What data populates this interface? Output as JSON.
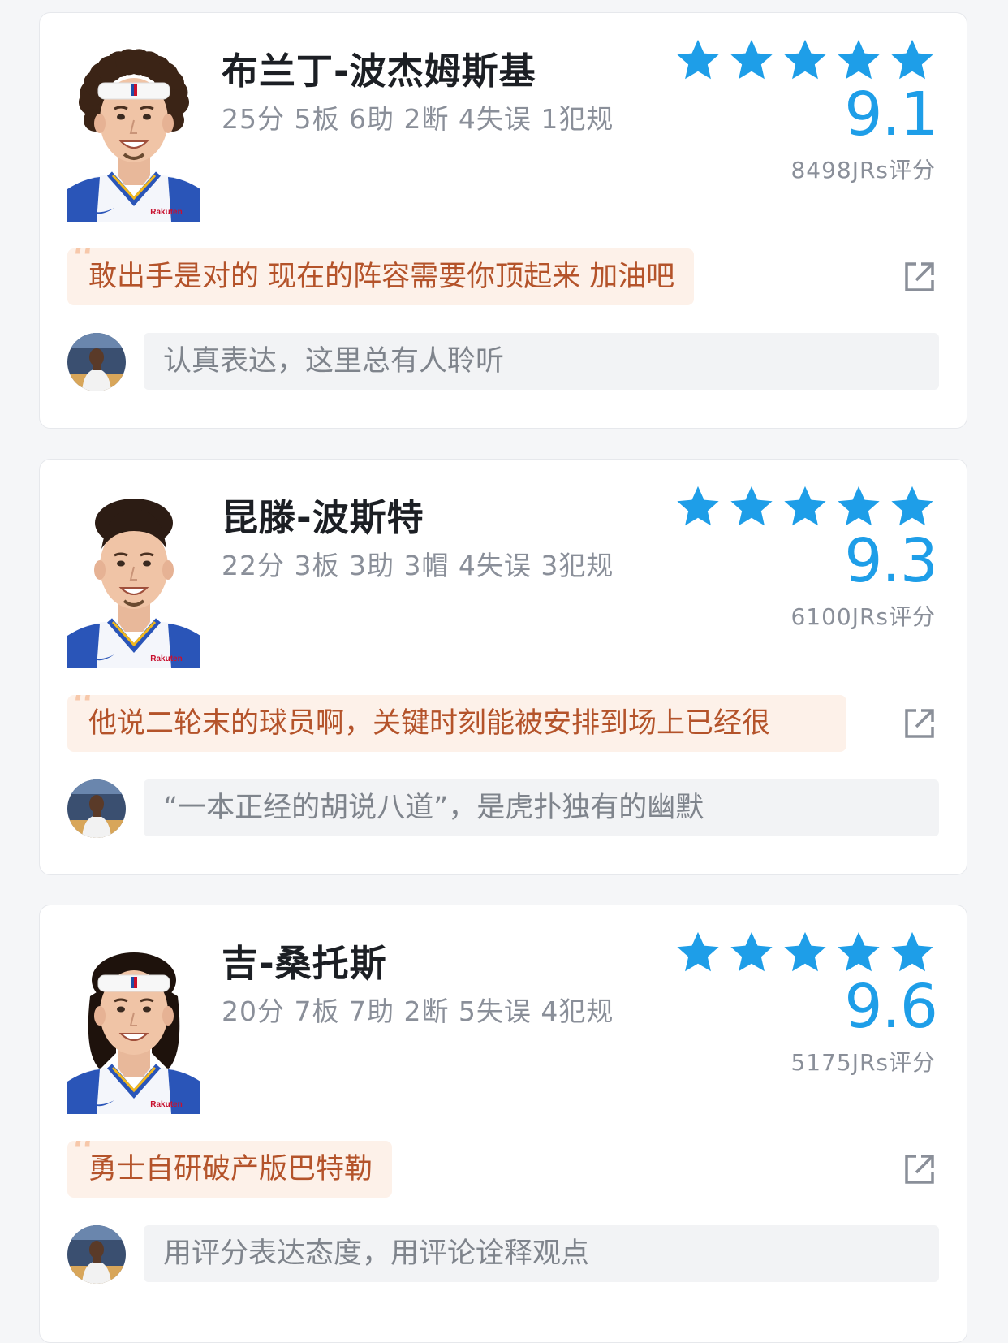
{
  "players": [
    {
      "name": "布兰丁-波杰姆斯基",
      "stats": "25分 5板 6助 2断 4失误 1犯规",
      "rating_stars": 5,
      "score": "9.1",
      "rater_count": "8498JRs评分",
      "hot_comment": "敢出手是对的 现在的阵容需要你顶起来 加油吧",
      "input_placeholder": "认真表达，这里总有人聆听",
      "jersey_sponsor": "Rakuten",
      "headband": true,
      "hair": "curly"
    },
    {
      "name": "昆滕-波斯特",
      "stats": "22分 3板 3助 3帽 4失误 3犯规",
      "rating_stars": 5,
      "score": "9.3",
      "rater_count": "6100JRs评分",
      "hot_comment": "他说二轮末的球员啊，关键时刻能被安排到场上已经很",
      "input_placeholder": "“一本正经的胡说八道”，是虎扑独有的幽默",
      "jersey_sponsor": "Rakuten",
      "headband": false,
      "hair": "short"
    },
    {
      "name": "吉-桑托斯",
      "stats": "20分 7板 7助 2断 5失误 4犯规",
      "rating_stars": 5,
      "score": "9.6",
      "rater_count": "5175JRs评分",
      "hot_comment": "勇士自研破产版巴特勒",
      "input_placeholder": "用评分表达态度，用评论诠释观点",
      "jersey_sponsor": "Rakuten",
      "headband": true,
      "hair": "long"
    }
  ],
  "icons": {
    "star": "star-icon",
    "share": "share-icon",
    "quote": "quote-icon"
  },
  "colors": {
    "score": "#1e9ee8",
    "star": "#1e9ee8",
    "hot_comment_bg": "#fdf1e9",
    "hot_comment_text": "#b4532a"
  }
}
